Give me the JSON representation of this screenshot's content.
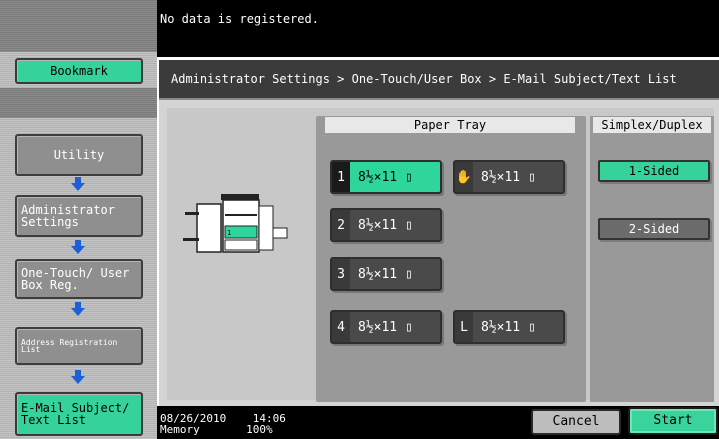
{
  "top_message": "No data is registered.",
  "sidebar": {
    "bookmark": "Bookmark",
    "utility": "Utility",
    "admin_settings": "Administrator Settings",
    "one_touch": "One-Touch/ User Box Reg.",
    "address_list": "Address Registration List",
    "email_subject": "E-Mail Subject/ Text List"
  },
  "breadcrumb": "Administrator Settings > One-Touch/User Box > E-Mail Subject/Text List",
  "paper_tray": {
    "heading": "Paper Tray",
    "trays": [
      {
        "num": "1",
        "label": "8½×11 ▯",
        "selected": true
      },
      {
        "num": "2",
        "label": "8½×11 ▯",
        "selected": false
      },
      {
        "num": "3",
        "label": "8½×11 ▯",
        "selected": false
      },
      {
        "num": "4",
        "label": "8½×11 ▯",
        "selected": false
      },
      {
        "num": "L",
        "label": "8½×11 ▯",
        "selected": false
      }
    ],
    "bypass_label": "8½×11 ▯"
  },
  "simplex_duplex": {
    "heading": "Simplex/Duplex",
    "one_sided": "1-Sided",
    "two_sided": "2-Sided",
    "selected": "1-Sided"
  },
  "status": {
    "date": "08/26/2010",
    "time": "14:06",
    "memory_label": "Memory",
    "memory_value": "100%"
  },
  "buttons": {
    "cancel": "Cancel",
    "start": "Start"
  },
  "colors": {
    "accent": "#35d29a",
    "background": "#000000"
  }
}
